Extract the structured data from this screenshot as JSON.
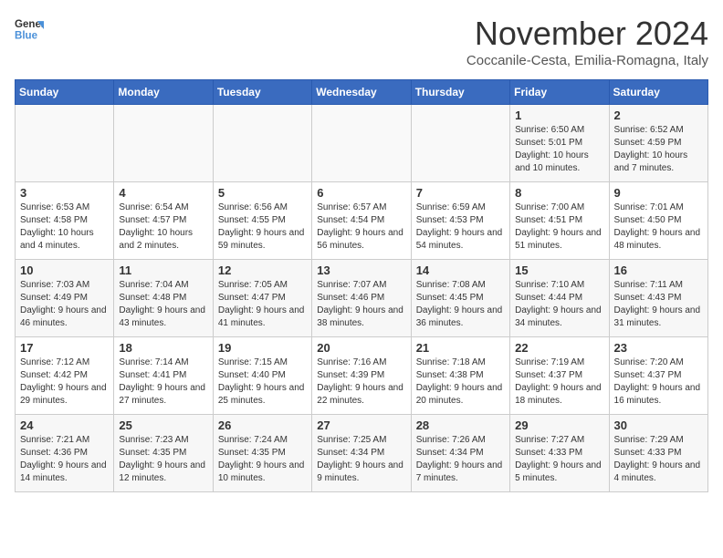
{
  "logo": {
    "line1": "General",
    "line2": "Blue"
  },
  "title": "November 2024",
  "subtitle": "Coccanile-Cesta, Emilia-Romagna, Italy",
  "headers": [
    "Sunday",
    "Monday",
    "Tuesday",
    "Wednesday",
    "Thursday",
    "Friday",
    "Saturday"
  ],
  "weeks": [
    [
      {
        "day": "",
        "info": ""
      },
      {
        "day": "",
        "info": ""
      },
      {
        "day": "",
        "info": ""
      },
      {
        "day": "",
        "info": ""
      },
      {
        "day": "",
        "info": ""
      },
      {
        "day": "1",
        "info": "Sunrise: 6:50 AM\nSunset: 5:01 PM\nDaylight: 10 hours and 10 minutes."
      },
      {
        "day": "2",
        "info": "Sunrise: 6:52 AM\nSunset: 4:59 PM\nDaylight: 10 hours and 7 minutes."
      }
    ],
    [
      {
        "day": "3",
        "info": "Sunrise: 6:53 AM\nSunset: 4:58 PM\nDaylight: 10 hours and 4 minutes."
      },
      {
        "day": "4",
        "info": "Sunrise: 6:54 AM\nSunset: 4:57 PM\nDaylight: 10 hours and 2 minutes."
      },
      {
        "day": "5",
        "info": "Sunrise: 6:56 AM\nSunset: 4:55 PM\nDaylight: 9 hours and 59 minutes."
      },
      {
        "day": "6",
        "info": "Sunrise: 6:57 AM\nSunset: 4:54 PM\nDaylight: 9 hours and 56 minutes."
      },
      {
        "day": "7",
        "info": "Sunrise: 6:59 AM\nSunset: 4:53 PM\nDaylight: 9 hours and 54 minutes."
      },
      {
        "day": "8",
        "info": "Sunrise: 7:00 AM\nSunset: 4:51 PM\nDaylight: 9 hours and 51 minutes."
      },
      {
        "day": "9",
        "info": "Sunrise: 7:01 AM\nSunset: 4:50 PM\nDaylight: 9 hours and 48 minutes."
      }
    ],
    [
      {
        "day": "10",
        "info": "Sunrise: 7:03 AM\nSunset: 4:49 PM\nDaylight: 9 hours and 46 minutes."
      },
      {
        "day": "11",
        "info": "Sunrise: 7:04 AM\nSunset: 4:48 PM\nDaylight: 9 hours and 43 minutes."
      },
      {
        "day": "12",
        "info": "Sunrise: 7:05 AM\nSunset: 4:47 PM\nDaylight: 9 hours and 41 minutes."
      },
      {
        "day": "13",
        "info": "Sunrise: 7:07 AM\nSunset: 4:46 PM\nDaylight: 9 hours and 38 minutes."
      },
      {
        "day": "14",
        "info": "Sunrise: 7:08 AM\nSunset: 4:45 PM\nDaylight: 9 hours and 36 minutes."
      },
      {
        "day": "15",
        "info": "Sunrise: 7:10 AM\nSunset: 4:44 PM\nDaylight: 9 hours and 34 minutes."
      },
      {
        "day": "16",
        "info": "Sunrise: 7:11 AM\nSunset: 4:43 PM\nDaylight: 9 hours and 31 minutes."
      }
    ],
    [
      {
        "day": "17",
        "info": "Sunrise: 7:12 AM\nSunset: 4:42 PM\nDaylight: 9 hours and 29 minutes."
      },
      {
        "day": "18",
        "info": "Sunrise: 7:14 AM\nSunset: 4:41 PM\nDaylight: 9 hours and 27 minutes."
      },
      {
        "day": "19",
        "info": "Sunrise: 7:15 AM\nSunset: 4:40 PM\nDaylight: 9 hours and 25 minutes."
      },
      {
        "day": "20",
        "info": "Sunrise: 7:16 AM\nSunset: 4:39 PM\nDaylight: 9 hours and 22 minutes."
      },
      {
        "day": "21",
        "info": "Sunrise: 7:18 AM\nSunset: 4:38 PM\nDaylight: 9 hours and 20 minutes."
      },
      {
        "day": "22",
        "info": "Sunrise: 7:19 AM\nSunset: 4:37 PM\nDaylight: 9 hours and 18 minutes."
      },
      {
        "day": "23",
        "info": "Sunrise: 7:20 AM\nSunset: 4:37 PM\nDaylight: 9 hours and 16 minutes."
      }
    ],
    [
      {
        "day": "24",
        "info": "Sunrise: 7:21 AM\nSunset: 4:36 PM\nDaylight: 9 hours and 14 minutes."
      },
      {
        "day": "25",
        "info": "Sunrise: 7:23 AM\nSunset: 4:35 PM\nDaylight: 9 hours and 12 minutes."
      },
      {
        "day": "26",
        "info": "Sunrise: 7:24 AM\nSunset: 4:35 PM\nDaylight: 9 hours and 10 minutes."
      },
      {
        "day": "27",
        "info": "Sunrise: 7:25 AM\nSunset: 4:34 PM\nDaylight: 9 hours and 9 minutes."
      },
      {
        "day": "28",
        "info": "Sunrise: 7:26 AM\nSunset: 4:34 PM\nDaylight: 9 hours and 7 minutes."
      },
      {
        "day": "29",
        "info": "Sunrise: 7:27 AM\nSunset: 4:33 PM\nDaylight: 9 hours and 5 minutes."
      },
      {
        "day": "30",
        "info": "Sunrise: 7:29 AM\nSunset: 4:33 PM\nDaylight: 9 hours and 4 minutes."
      }
    ]
  ]
}
